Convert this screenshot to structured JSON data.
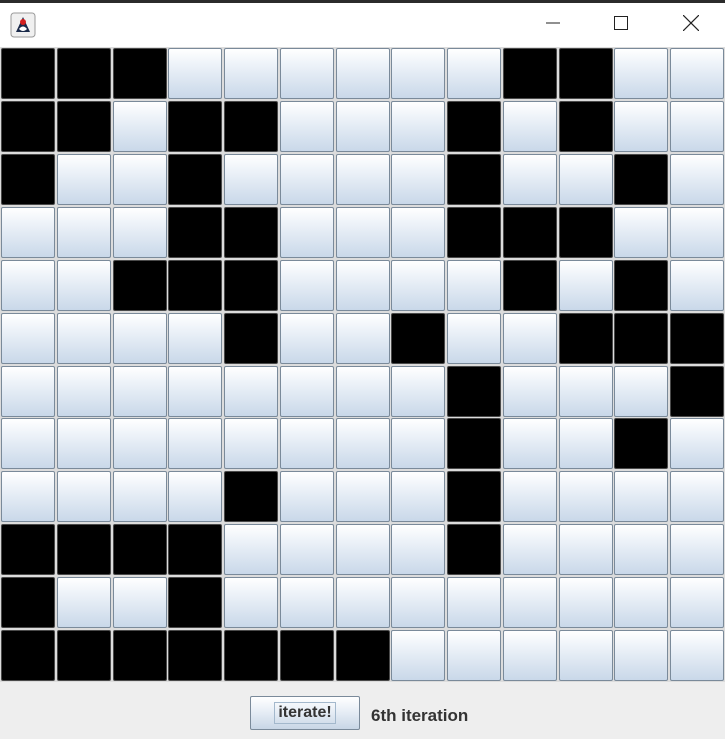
{
  "window": {
    "icons": {
      "app": "java-duke-icon",
      "minimize": "minimize-icon",
      "maximize": "maximize-icon",
      "close": "close-icon"
    }
  },
  "grid": {
    "rows": 12,
    "cols": 13,
    "on_color": "#000000",
    "off_color": "#dbe6f3",
    "cells": [
      "1110000001100",
      "1101100010100",
      "1001000010010",
      "0001100011100",
      "0011100001010",
      "0000100100111",
      "0000000010001",
      "0000000010010",
      "0000100010000",
      "1111000010000",
      "1001000000000",
      "1111111000000"
    ]
  },
  "controls": {
    "iterate_label": "iterate!",
    "status_text": "6th iteration"
  }
}
